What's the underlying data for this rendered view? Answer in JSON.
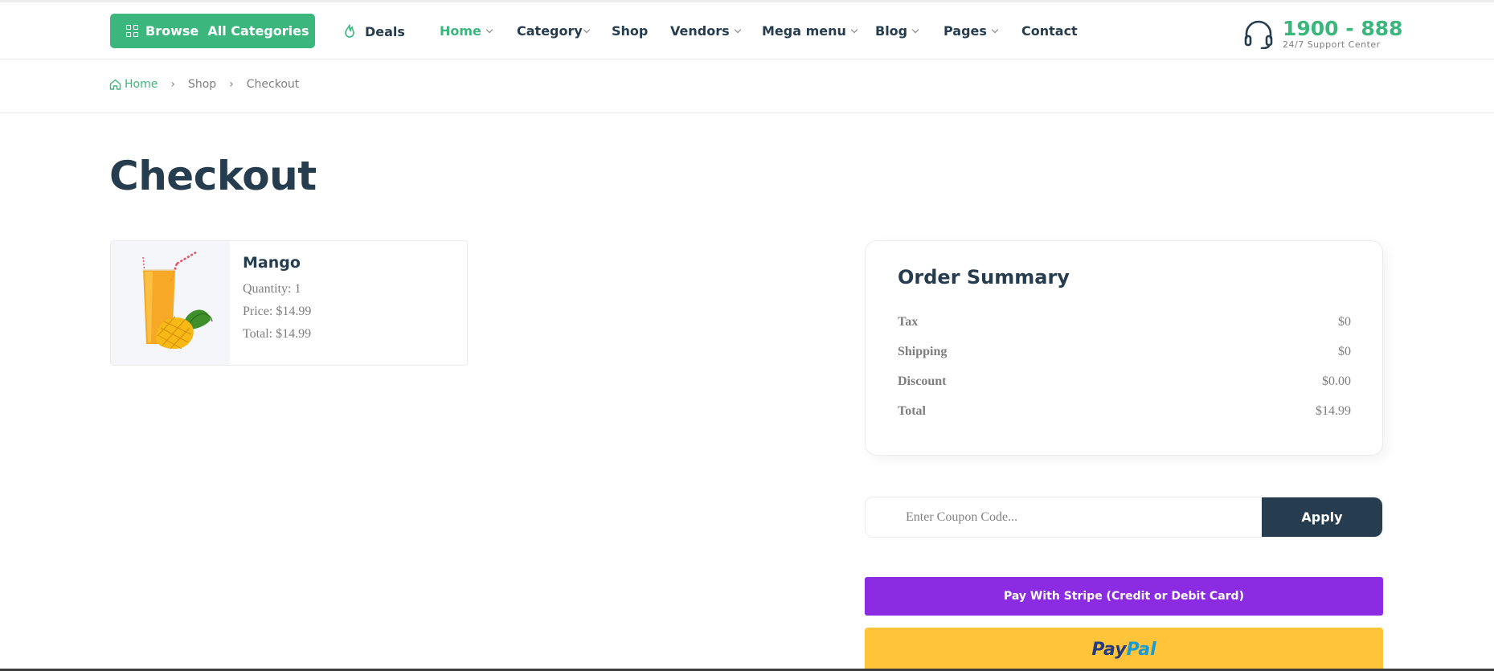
{
  "header": {
    "browse_label": "Browse  All Categories",
    "deals_label": "Deals",
    "nav": [
      {
        "label": "Home",
        "has_caret": true,
        "active": true
      },
      {
        "label": "Category",
        "has_caret": true,
        "active": false
      },
      {
        "label": "Shop",
        "has_caret": false,
        "active": false
      },
      {
        "label": "Vendors",
        "has_caret": true,
        "active": false
      },
      {
        "label": "Mega menu",
        "has_caret": true,
        "active": false
      },
      {
        "label": "Blog",
        "has_caret": true,
        "active": false
      },
      {
        "label": "Pages",
        "has_caret": true,
        "active": false
      },
      {
        "label": "Contact",
        "has_caret": false,
        "active": false
      }
    ],
    "support_number": "1900 - 888",
    "support_text": "24/7 Support Center"
  },
  "breadcrumb": {
    "home": "Home",
    "separator": "›",
    "shop": "Shop",
    "current": "Checkout"
  },
  "page_title": "Checkout",
  "cart_item": {
    "name": "Mango",
    "quantity": "Quantity: 1",
    "price": "Price: $14.99",
    "total": "Total: $14.99"
  },
  "summary": {
    "title": "Order Summary",
    "rows": [
      {
        "label": "Tax",
        "value": "$0"
      },
      {
        "label": "Shipping",
        "value": "$0"
      },
      {
        "label": "Discount",
        "value": "$0.00"
      },
      {
        "label": "Total",
        "value": "$14.99"
      }
    ]
  },
  "coupon": {
    "placeholder": "Enter Coupon Code...",
    "apply_label": "Apply"
  },
  "payment": {
    "stripe_label": "Pay With Stripe (Credit or Debit Card)",
    "paypal_part1": "Pay",
    "paypal_part2": "Pal"
  },
  "colors": {
    "brand_green": "#3bb77e",
    "heading_dark": "#253d4e",
    "stripe_purple": "#8b2ce2",
    "paypal_yellow": "#ffc439"
  },
  "icons": [
    "grid-icon",
    "chevron-down-icon",
    "flame-icon",
    "headset-icon",
    "home-icon",
    "mango-juice-image"
  ]
}
